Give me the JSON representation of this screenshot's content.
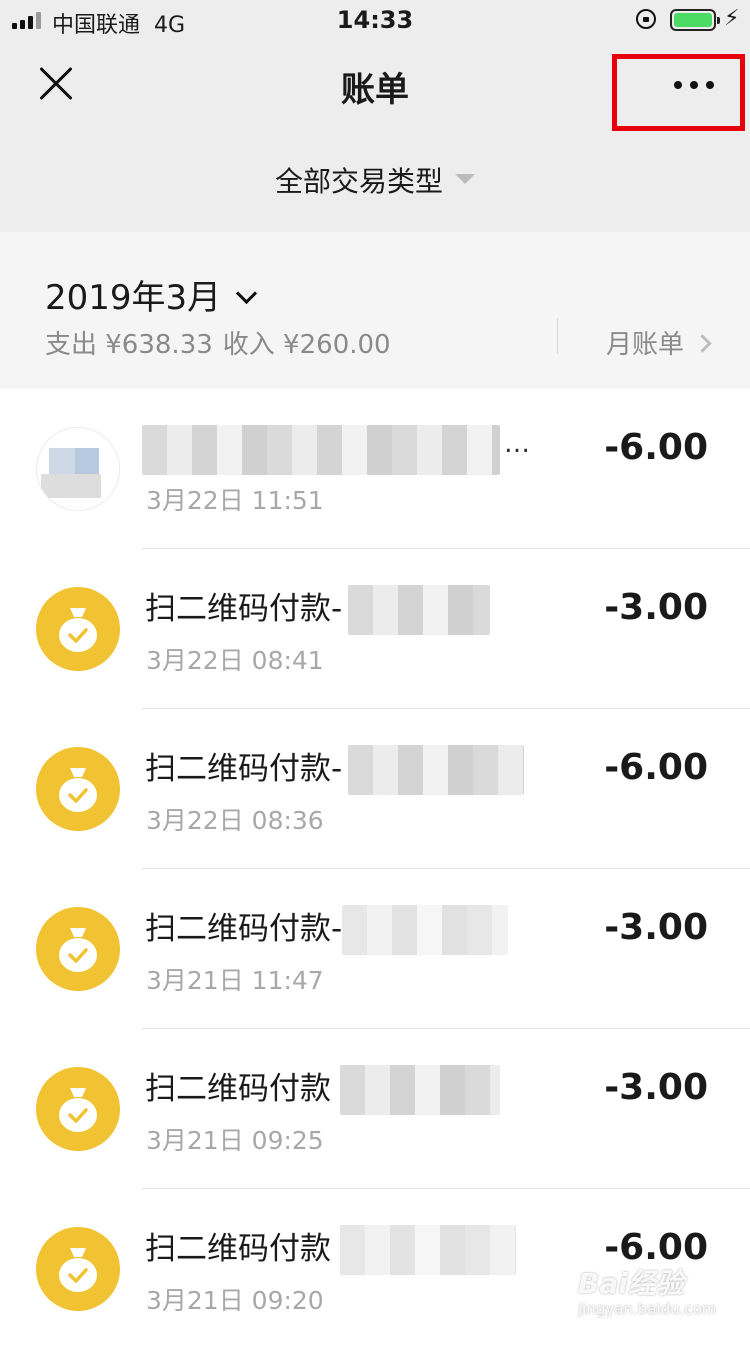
{
  "status_bar": {
    "carrier": "中国联通",
    "network": "4G",
    "time": "14:33",
    "battery_color": "#4cd964"
  },
  "nav": {
    "close_icon": "close-icon",
    "title": "账单",
    "more_icon": "more-dots-icon",
    "highlight_color": "#e8000b"
  },
  "filter": {
    "label": "全部交易类型"
  },
  "month_summary": {
    "month": "2019年3月",
    "expense_label": "支出 ¥638.33",
    "income_label": "收入 ¥260.00",
    "monthly_bill": "月账单"
  },
  "transactions": [
    {
      "icon": "avatar",
      "name": "",
      "time": "3月22日 11:51",
      "amount": "-6.00"
    },
    {
      "icon": "money-bag-icon",
      "name": "扫二维码付款-",
      "time": "3月22日 08:41",
      "amount": "-3.00"
    },
    {
      "icon": "money-bag-icon",
      "name": "扫二维码付款-",
      "time": "3月22日 08:36",
      "amount": "-6.00"
    },
    {
      "icon": "money-bag-icon",
      "name": "扫二维码付款-",
      "time": "3月21日 11:47",
      "amount": "-3.00"
    },
    {
      "icon": "money-bag-icon",
      "name": "扫二维码付款",
      "time": "3月21日 09:25",
      "amount": "-3.00"
    },
    {
      "icon": "money-bag-icon",
      "name": "扫二维码付款",
      "time": "3月21日 09:20",
      "amount": "-6.00"
    }
  ],
  "colors": {
    "icon_yellow": "#f1c232",
    "header_bg": "#ededed",
    "summary_bg": "#f5f5f5"
  },
  "watermark": {
    "brand": "Bai经验",
    "url": "jingyan.baidu.com"
  }
}
